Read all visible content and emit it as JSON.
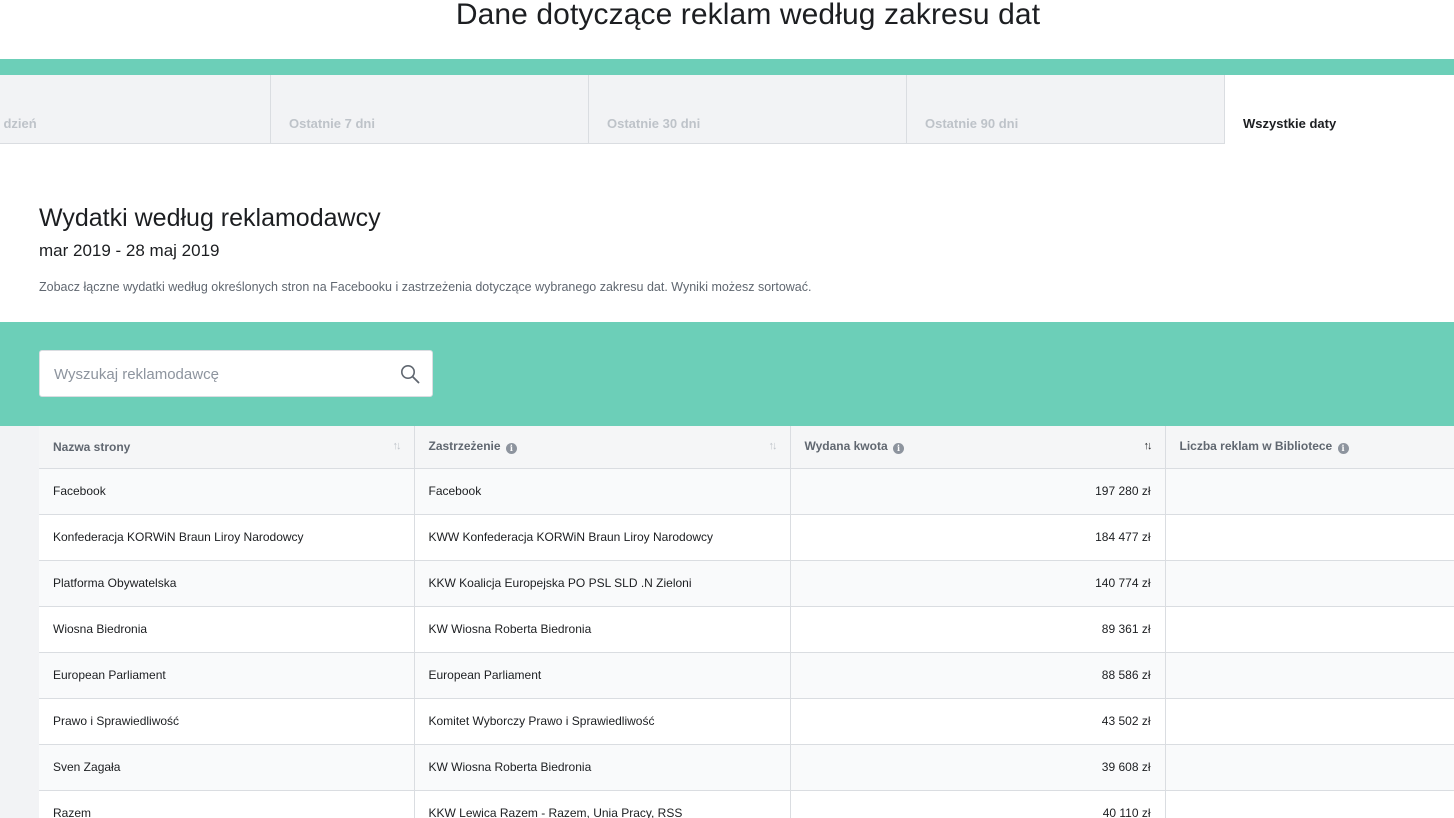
{
  "header": {
    "title": "Dane dotyczące reklam według zakresu dat"
  },
  "tabs": [
    {
      "label": "Ostatni dzień",
      "visible_label": "tni dzień"
    },
    {
      "label": "Ostatnie 7 dni"
    },
    {
      "label": "Ostatnie 30 dni"
    },
    {
      "label": "Ostatnie 90 dni"
    },
    {
      "label": "Wszystkie daty",
      "active": true
    }
  ],
  "section": {
    "title": "Wydatki według reklamodawcy",
    "range": "mar 2019 - 28 maj 2019",
    "description": "Zobacz łączne wydatki według określonych stron na Facebooku i zastrzeżenia dotyczące wybranego zakresu dat. Wyniki możesz sortować."
  },
  "search": {
    "placeholder": "Wyszukaj reklamodawcę",
    "value": ""
  },
  "table": {
    "columns": [
      {
        "label": "Nazwa strony",
        "info": false,
        "sort": "inactive"
      },
      {
        "label": "Zastrzeżenie",
        "info": true,
        "sort": "inactive"
      },
      {
        "label": "Wydana kwota",
        "info": true,
        "sort": "active"
      },
      {
        "label": "Liczba reklam w Bibliotece",
        "info": true,
        "sort": "none"
      }
    ],
    "rows": [
      {
        "page": "Facebook",
        "disclaimer": "Facebook",
        "amount": "197 280 zł",
        "ads": ""
      },
      {
        "page": "Konfederacja KORWiN Braun Liroy Narodowcy",
        "disclaimer": "KWW Konfederacja KORWiN Braun Liroy Narodowcy",
        "amount": "184 477 zł",
        "ads": ""
      },
      {
        "page": "Platforma Obywatelska",
        "disclaimer": "KKW Koalicja Europejska PO PSL SLD .N Zieloni",
        "amount": "140 774 zł",
        "ads": ""
      },
      {
        "page": "Wiosna Biedronia",
        "disclaimer": "KW Wiosna Roberta Biedronia",
        "amount": "89 361 zł",
        "ads": ""
      },
      {
        "page": "European Parliament",
        "disclaimer": "European Parliament",
        "amount": "88 586 zł",
        "ads": ""
      },
      {
        "page": "Prawo i Sprawiedliwość",
        "disclaimer": "Komitet Wyborczy Prawo i Sprawiedliwość",
        "amount": "43 502 zł",
        "ads": ""
      },
      {
        "page": "Sven Zagała",
        "disclaimer": "KW Wiosna Roberta Biedronia",
        "amount": "39 608 zł",
        "ads": ""
      },
      {
        "page": "Razem",
        "disclaimer": "KKW Lewica Razem - Razem, Unia Pracy, RSS",
        "amount": "40 110 zł",
        "ads": ""
      }
    ]
  },
  "colors": {
    "accent": "#6ccfb8",
    "tab_bg": "#f2f3f5",
    "text": "#1c1e21",
    "muted": "#606770"
  },
  "icons": {
    "search": "search-icon",
    "info": "info-icon",
    "sort": "sort-arrows-icon"
  }
}
